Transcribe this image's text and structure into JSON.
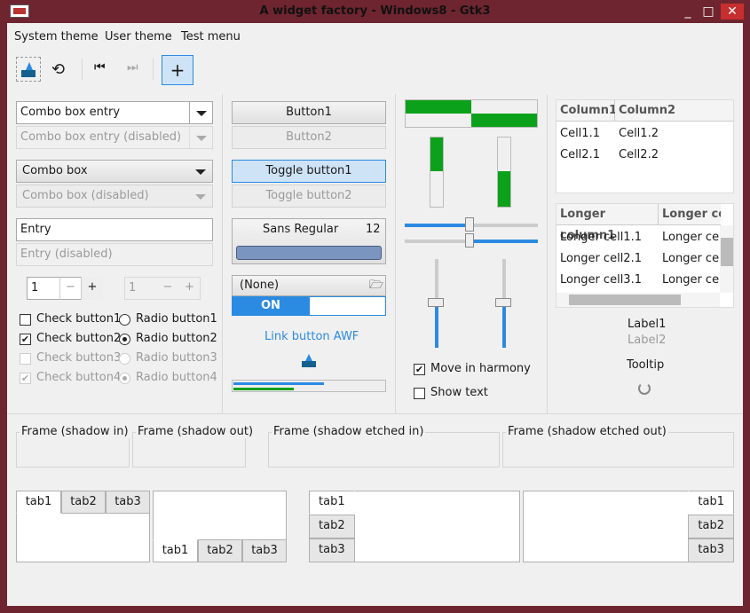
{
  "window": {
    "title": "A widget factory - Windows8 - Gtk3",
    "min": "_",
    "max": "□",
    "close": "✕"
  },
  "menu": [
    "System theme",
    "User theme",
    "Test menu"
  ],
  "col1": {
    "combo_entry": "Combo box entry",
    "combo_entry_dis": "Combo box entry (disabled)",
    "combo": "Combo box",
    "combo_dis": "Combo box (disabled)",
    "entry": "Entry",
    "entry_dis": "Entry (disabled)",
    "spin1": "1",
    "spin2": "1",
    "minus": "−",
    "plus": "+",
    "check1": "Check button1",
    "check2": "Check button2",
    "check3": "Check button3",
    "check4": "Check button4",
    "radio1": "Radio button1",
    "radio2": "Radio button2",
    "radio3": "Radio button3",
    "radio4": "Radio button4"
  },
  "col2": {
    "button1": "Button1",
    "button2": "Button2",
    "toggle1": "Toggle button1",
    "toggle2": "Toggle button2",
    "font_name": "Sans Regular",
    "font_size": "12",
    "file_none": "(None)",
    "switch_on": "ON",
    "link": "Link button AWF"
  },
  "col3": {
    "move": "Move in harmony",
    "show_text": "Show text"
  },
  "col4": {
    "tree1": {
      "headers": [
        "Column1",
        "Column2"
      ],
      "rows": [
        [
          "Cell1.1",
          "Cell1.2"
        ],
        [
          "Cell2.1",
          "Cell2.2"
        ]
      ]
    },
    "tree2": {
      "headers": [
        "Longer column1",
        "Longer co"
      ],
      "rows": [
        [
          "Longer cell1.1",
          "Longer cell"
        ],
        [
          "Longer cell2.1",
          "Longer cell"
        ],
        [
          "Longer cell3.1",
          "Longer cell"
        ]
      ]
    },
    "label1": "Label1",
    "label2": "Label2",
    "tooltip": "Tooltip"
  },
  "frames": [
    "Frame (shadow in)",
    "Frame (shadow out)",
    "Frame (shadow etched in)",
    "Frame (shadow etched out)"
  ],
  "tabs": [
    "tab1",
    "tab2",
    "tab3"
  ],
  "colors": {
    "accent": "#2b8ae2",
    "green": "#0ca11a",
    "frame": "#6f2530"
  }
}
